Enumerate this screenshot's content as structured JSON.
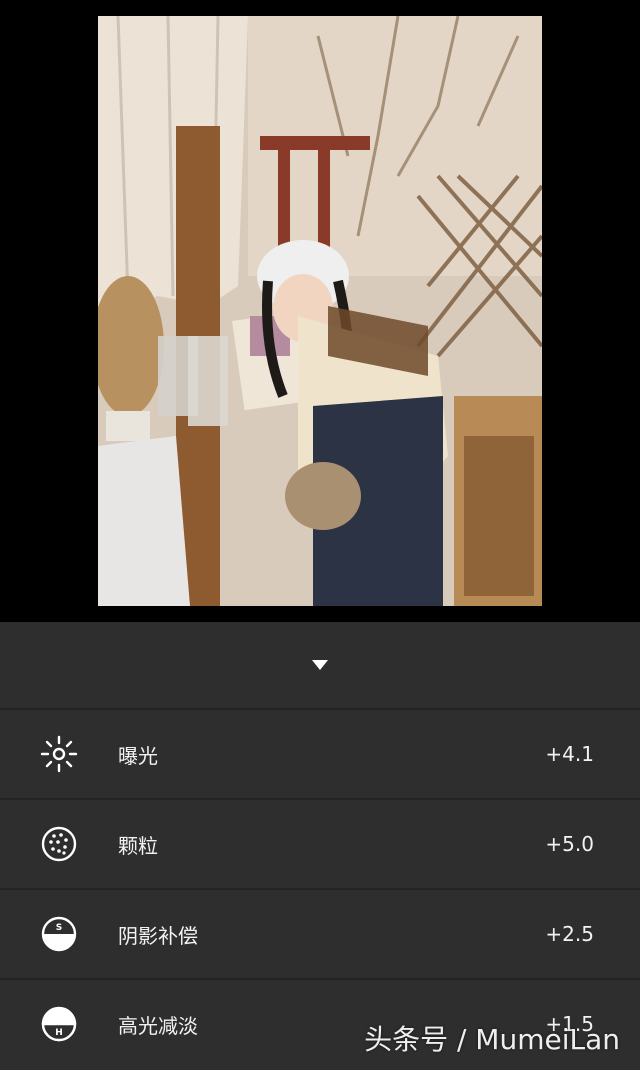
{
  "photo": {
    "description_icon": "image-icon"
  },
  "panel": {
    "collapse_icon": "triangle-down-icon",
    "adjustments": [
      {
        "icon": "sun-icon",
        "label": "曝光",
        "value": "+4.1"
      },
      {
        "icon": "grain-icon",
        "label": "颗粒",
        "value": "+5.0"
      },
      {
        "icon": "shadow-icon",
        "label": "阴影补偿",
        "value": "+2.5"
      },
      {
        "icon": "highlight-icon",
        "label": "高光减淡",
        "value": "+1.5"
      }
    ]
  },
  "watermark": "头条号 / MumeiLan"
}
